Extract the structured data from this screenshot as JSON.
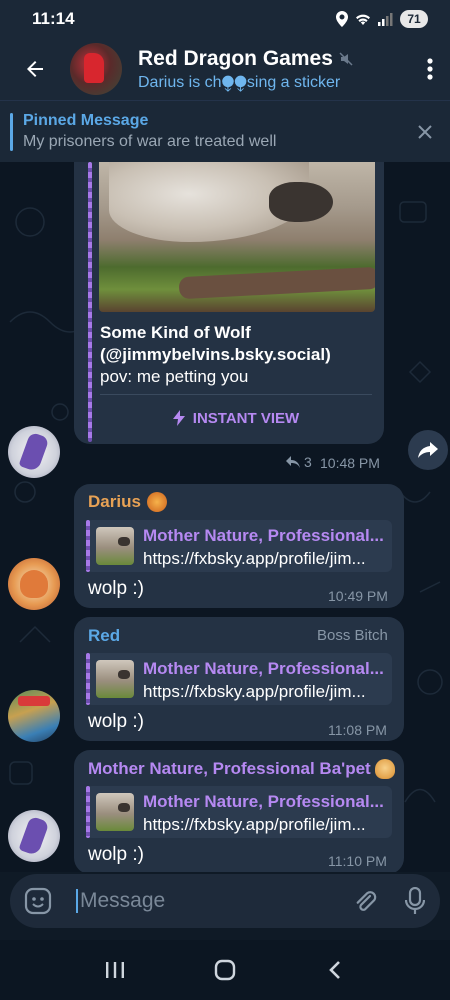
{
  "status_bar": {
    "time": "11:14",
    "battery": "71"
  },
  "header": {
    "title": "Red Dragon Games",
    "status": "Darius is ch⧭⧭sing a sticker"
  },
  "pinned": {
    "title": "Pinned Message",
    "text": "My prisoners of war are treated well"
  },
  "messages": [
    {
      "type": "link_preview_full",
      "site_title": "Some Kind of Wolf (@jimmybelvins.bsky.social)",
      "description": "pov: me petting you",
      "button": "INSTANT VIEW",
      "reply_count": "3",
      "time": "10:48 PM"
    },
    {
      "sender": "Darius",
      "link_title": "Mother Nature, Professional...",
      "link_url": "https://fxbsky.app/profile/jim...",
      "text": "wolp :)",
      "time": "10:49 PM"
    },
    {
      "sender": "Red",
      "sender_tag": "Boss Bitch",
      "link_title": "Mother Nature, Professional...",
      "link_url": "https://fxbsky.app/profile/jim...",
      "text": "wolp :)",
      "time": "11:08 PM"
    },
    {
      "sender": "Mother Nature, Professional Ba'pet",
      "link_title": "Mother Nature, Professional...",
      "link_url": "https://fxbsky.app/profile/jim...",
      "text": "wolp :)",
      "time": "11:10 PM"
    }
  ],
  "input": {
    "placeholder": "Message"
  },
  "colors": {
    "accent_blue": "#5ba8e6",
    "link_purple": "#b689f2",
    "darius_orange": "#e8a255",
    "red_blue": "#5ba8e6",
    "bubble": "#243244"
  }
}
